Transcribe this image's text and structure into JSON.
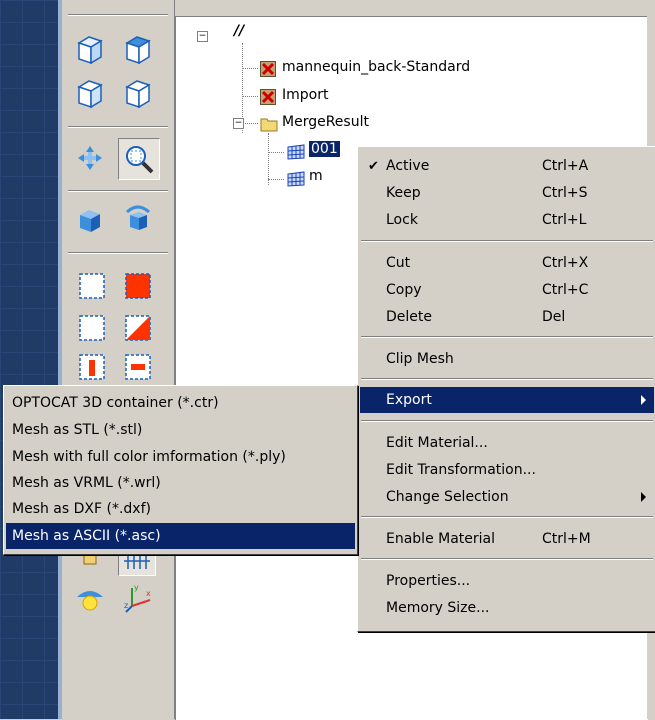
{
  "tree": {
    "root_label": "//",
    "items": [
      {
        "label": "mannequin_back-Standard",
        "icon": "x-box-icon"
      },
      {
        "label": "Import",
        "icon": "x-box-icon"
      },
      {
        "label": "MergeResult",
        "icon": "folder-icon"
      },
      {
        "label": "001",
        "icon": "mesh-icon"
      },
      {
        "label": "m",
        "icon": "mesh-icon"
      }
    ]
  },
  "context_menu": {
    "items": [
      {
        "label": "Active",
        "shortcut": "Ctrl+A",
        "checked": true
      },
      {
        "label": "Keep",
        "shortcut": "Ctrl+S"
      },
      {
        "label": "Lock",
        "shortcut": "Ctrl+L"
      },
      {
        "label": "Cut",
        "shortcut": "Ctrl+X"
      },
      {
        "label": "Copy",
        "shortcut": "Ctrl+C"
      },
      {
        "label": "Delete",
        "shortcut": "Del"
      },
      {
        "label": "Clip Mesh",
        "shortcut": ""
      },
      {
        "label": "Export",
        "shortcut": "",
        "highlighted": true
      },
      {
        "label": "Edit Material...",
        "shortcut": ""
      },
      {
        "label": "Edit Transformation...",
        "shortcut": ""
      },
      {
        "label": "Change Selection",
        "shortcut": ""
      },
      {
        "label": "Enable Material",
        "shortcut": "Ctrl+M"
      },
      {
        "label": "Properties...",
        "shortcut": ""
      },
      {
        "label": "Memory Size...",
        "shortcut": ""
      }
    ]
  },
  "export_submenu": {
    "items": [
      {
        "label": "OPTOCAT 3D container (*.ctr)"
      },
      {
        "label": "Mesh as STL (*.stl)"
      },
      {
        "label": "Mesh with full color imformation (*.ply)"
      },
      {
        "label": "Mesh as VRML (*.wrl)"
      },
      {
        "label": "Mesh as DXF (*.dxf)"
      },
      {
        "label": "Mesh as ASCII (*.asc)",
        "highlighted": true
      }
    ]
  },
  "colors": {
    "highlight": "#0a246a",
    "menu_bg": "#d4d0c8",
    "selection_red": "#ff3300",
    "tool_blue": "#3d8fdc"
  }
}
